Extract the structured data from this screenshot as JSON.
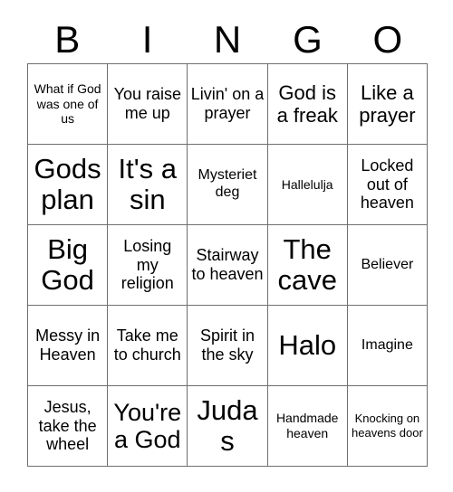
{
  "card": {
    "title": "BINGO",
    "header_letters": [
      "B",
      "I",
      "N",
      "G",
      "O"
    ],
    "rows": 5,
    "columns": 5,
    "colors": {
      "background": "#ffffff",
      "text": "#000000",
      "grid_line": "#6f6f6f"
    },
    "cells": [
      [
        {
          "text": "What if God was one of us",
          "size": "xs"
        },
        {
          "text": "You raise me up",
          "size": "md"
        },
        {
          "text": "Livin' on a prayer",
          "size": "md"
        },
        {
          "text": "God is a freak",
          "size": "lg"
        },
        {
          "text": "Like a prayer",
          "size": "lg"
        }
      ],
      [
        {
          "text": "Gods plan",
          "size": "xxl"
        },
        {
          "text": "It's a sin",
          "size": "xxl"
        },
        {
          "text": "Mysteriet deg",
          "size": "sm"
        },
        {
          "text": "Hallelulja",
          "size": "xs"
        },
        {
          "text": "Locked out of heaven",
          "size": "md"
        }
      ],
      [
        {
          "text": "Big God",
          "size": "xxl"
        },
        {
          "text": "Losing my religion",
          "size": "md"
        },
        {
          "text": "Stairway to heaven",
          "size": "md"
        },
        {
          "text": "The cave",
          "size": "xxl"
        },
        {
          "text": "Believer",
          "size": "sm"
        }
      ],
      [
        {
          "text": "Messy in Heaven",
          "size": "md"
        },
        {
          "text": "Take me to church",
          "size": "md"
        },
        {
          "text": "Spirit in the sky",
          "size": "md"
        },
        {
          "text": "Halo",
          "size": "xxl"
        },
        {
          "text": "Imagine",
          "size": "sm"
        }
      ],
      [
        {
          "text": "Jesus, take the wheel",
          "size": "md"
        },
        {
          "text": "You're a God",
          "size": "xl"
        },
        {
          "text": "Judas",
          "size": "xxl"
        },
        {
          "text": "Handmade heaven",
          "size": "xs"
        },
        {
          "text": "Knocking on heavens door",
          "size": "xxs"
        }
      ]
    ]
  }
}
